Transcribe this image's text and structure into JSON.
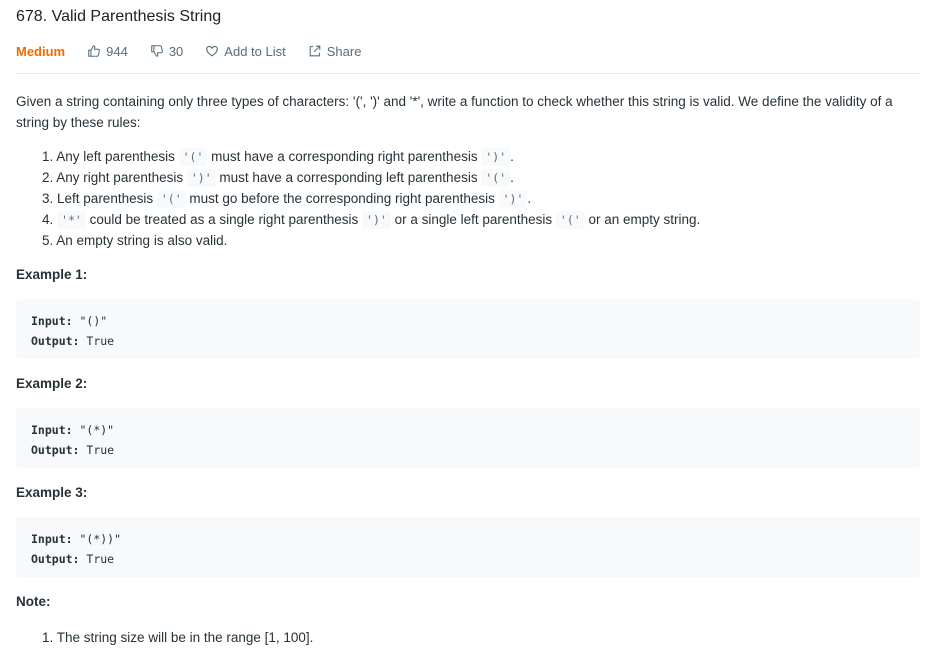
{
  "problem": {
    "title": "678. Valid Parenthesis String",
    "difficulty": "Medium",
    "likes": "944",
    "dislikes": "30",
    "add_to_list": "Add to List",
    "share": "Share"
  },
  "description": {
    "intro": "Given a string containing only three types of characters: '(', ')' and '*', write a function to check whether this string is valid. We define the validity of a string by these rules:",
    "rules": [
      {
        "num": "1.",
        "a": "Any left parenthesis",
        "c1": "'('",
        "b": "must have a corresponding right parenthesis",
        "c2": "')'",
        "end": "."
      },
      {
        "num": "2.",
        "a": "Any right parenthesis",
        "c1": "')'",
        "b": "must have a corresponding left parenthesis",
        "c2": "'('",
        "end": "."
      },
      {
        "num": "3.",
        "a": "Left parenthesis",
        "c1": "'('",
        "b": "must go before the corresponding right parenthesis",
        "c2": "')'",
        "end": "."
      },
      {
        "num": "4.",
        "c0": "'*'",
        "a": "could be treated as a single right parenthesis",
        "c1": "')'",
        "b": "or a single left parenthesis",
        "c2": "'('",
        "end": "or an empty string."
      },
      {
        "num": "5.",
        "text": "An empty string is also valid."
      }
    ]
  },
  "examples": [
    {
      "heading": "Example 1:",
      "input_label": "Input:",
      "input": "\"()\"",
      "output_label": "Output:",
      "output": "True"
    },
    {
      "heading": "Example 2:",
      "input_label": "Input:",
      "input": "\"(*)\"",
      "output_label": "Output:",
      "output": "True"
    },
    {
      "heading": "Example 3:",
      "input_label": "Input:",
      "input": "\"(*))\"",
      "output_label": "Output:",
      "output": "True"
    }
  ],
  "note": {
    "heading": "Note:",
    "items": [
      {
        "num": "1.",
        "text": "The string size will be in the range [1, 100]."
      }
    ]
  }
}
